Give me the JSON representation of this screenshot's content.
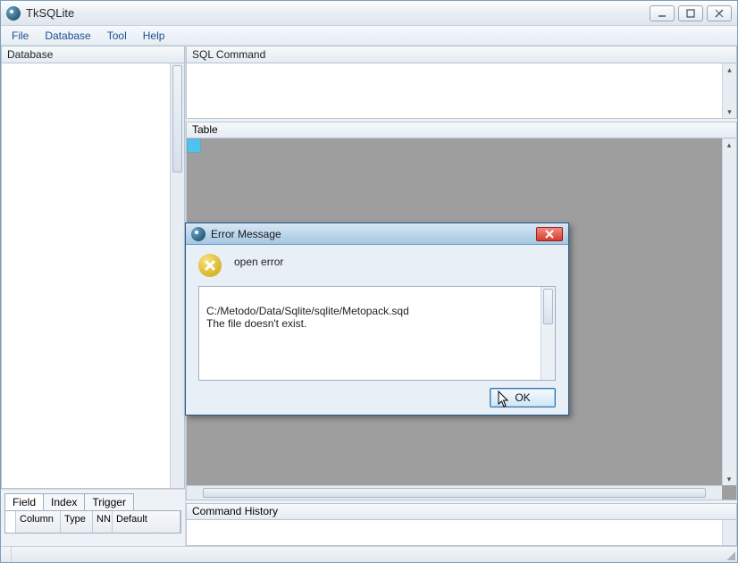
{
  "app": {
    "title": "TkSQLite"
  },
  "menu": {
    "file": "File",
    "database": "Database",
    "tool": "Tool",
    "help": "Help"
  },
  "panels": {
    "database": "Database",
    "sql_command": "SQL Command",
    "table": "Table",
    "command_history": "Command History"
  },
  "tabs": {
    "field": "Field",
    "index": "Index",
    "trigger": "Trigger"
  },
  "field_columns": {
    "column": "Column",
    "type": "Type",
    "nn": "NN",
    "default": "Default"
  },
  "dialog": {
    "title": "Error Message",
    "heading": "open error",
    "detail": "C:/Metodo/Data/Sqlite/sqlite/Metopack.sqd\nThe file doesn't exist.",
    "ok": "OK"
  }
}
